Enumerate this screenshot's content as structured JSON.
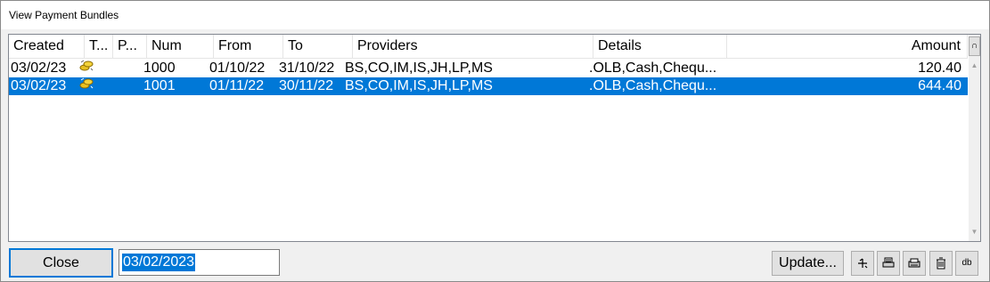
{
  "window": {
    "title": "View Payment Bundles"
  },
  "columns": [
    "Created",
    "T...",
    "P...",
    "Num",
    "From",
    "To",
    "Providers",
    "Details",
    "Amount"
  ],
  "rows": [
    {
      "created": "03/02/23",
      "type_icon": "gold-coins-icon",
      "p": "",
      "num": "1000",
      "from": "01/10/22",
      "to": "31/10/22",
      "providers": "BS,CO,IM,IS,JH,LP,MS",
      "details": ".OLB,Cash,Chequ...",
      "amount": "120.40",
      "selected": false
    },
    {
      "created": "03/02/23",
      "type_icon": "gold-coins-icon",
      "p": "",
      "num": "1001",
      "from": "01/11/22",
      "to": "30/11/22",
      "providers": "BS,CO,IM,IS,JH,LP,MS",
      "details": ".OLB,Cash,Chequ...",
      "amount": "644.40",
      "selected": true
    }
  ],
  "header_corner": "∩",
  "footer": {
    "close_label": "Close",
    "date_value": "03/02/2023",
    "update_label": "Update...",
    "tool_buttons": [
      {
        "name": "edit-bundle-button",
        "glyph": "ɸɨ"
      },
      {
        "name": "print-preview-button",
        "glyph": "⎙"
      },
      {
        "name": "print-button",
        "glyph": "⎙"
      },
      {
        "name": "delete-button",
        "glyph": "⌦"
      },
      {
        "name": "database-button",
        "glyph": "db"
      }
    ]
  },
  "colors": {
    "selection": "#0078d7",
    "button_face": "#e1e1e1"
  }
}
